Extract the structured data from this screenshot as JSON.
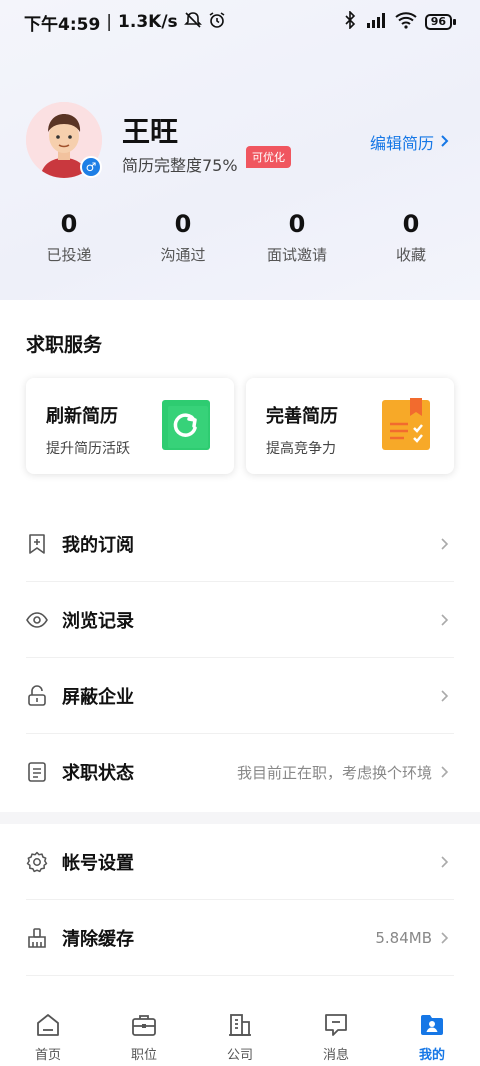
{
  "status_bar": {
    "time": "下午4:59",
    "speed": "1.3K/s",
    "battery": "96"
  },
  "profile": {
    "name": "王旺",
    "completeness": "简历完整度75%",
    "tag": "可优化",
    "edit_label": "编辑简历"
  },
  "stats": [
    {
      "value": "0",
      "label": "已投递"
    },
    {
      "value": "0",
      "label": "沟通过"
    },
    {
      "value": "0",
      "label": "面试邀请"
    },
    {
      "value": "0",
      "label": "收藏"
    }
  ],
  "services": {
    "title": "求职服务",
    "cards": [
      {
        "title": "刷新简历",
        "subtitle": "提升简历活跃",
        "icon": "refresh-icon",
        "color": "#2ecc71"
      },
      {
        "title": "完善简历",
        "subtitle": "提高竞争力",
        "icon": "notebook-icon",
        "color": "#f7a928"
      }
    ]
  },
  "menu": [
    {
      "label": "我的订阅",
      "value": "",
      "icon": "bookmark-icon"
    },
    {
      "label": "浏览记录",
      "value": "",
      "icon": "eye-icon"
    },
    {
      "label": "屏蔽企业",
      "value": "",
      "icon": "lock-icon"
    },
    {
      "label": "求职状态",
      "value": "我目前正在职，考虑换个环境",
      "icon": "document-icon"
    },
    {
      "label": "帐号设置",
      "value": "",
      "icon": "gear-icon"
    },
    {
      "label": "清除缓存",
      "value": "5.84MB",
      "icon": "broom-icon"
    }
  ],
  "nav": [
    {
      "label": "首页",
      "icon": "home-icon",
      "active": false
    },
    {
      "label": "职位",
      "icon": "briefcase-icon",
      "active": false
    },
    {
      "label": "公司",
      "icon": "building-icon",
      "active": false
    },
    {
      "label": "消息",
      "icon": "message-icon",
      "active": false
    },
    {
      "label": "我的",
      "icon": "profile-icon",
      "active": true
    }
  ],
  "colors": {
    "accent": "#1677e6",
    "tag": "#f0565f"
  }
}
